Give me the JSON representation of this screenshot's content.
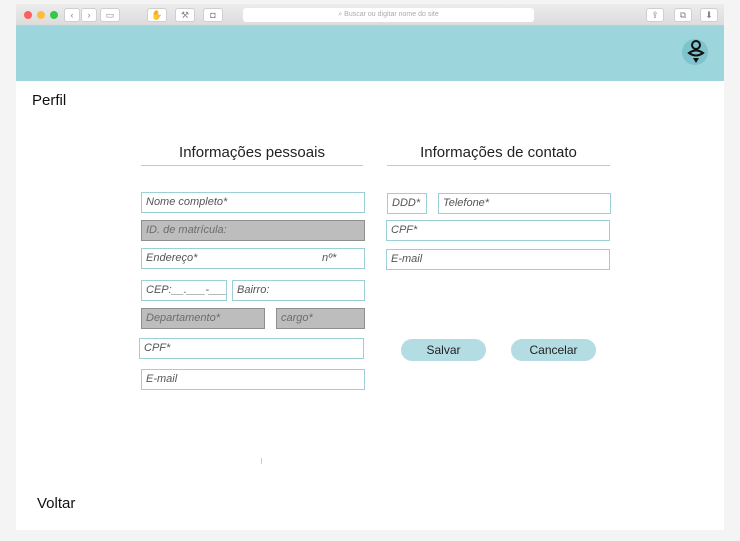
{
  "browser": {
    "address_placeholder": "Buscar ou digitar nome do site"
  },
  "header": {
    "avatar_icon": "user-avatar-icon",
    "colors": {
      "topbar": "#9dd5dc",
      "field_border": "#9ccfd6",
      "button": "#b3dde2"
    }
  },
  "page": {
    "title": "Perfil",
    "back_label": "Voltar"
  },
  "personal": {
    "title": "Informações pessoais",
    "full_name": "Nome completo*",
    "enrollment_id": "ID. de matrícula:",
    "address": "Endereço*",
    "number": "nº*",
    "cep": "CEP:__.___-___",
    "neighborhood": "Bairro:",
    "department": "Departamento*",
    "role": "cargo*",
    "cpf": "CPF*",
    "email": "E-mail"
  },
  "contact": {
    "title": "Informações de contato",
    "ddd": "DDD*",
    "phone": "Telefone*",
    "cpf": "CPF*",
    "email": "E-mail"
  },
  "actions": {
    "save_label": "Salvar",
    "cancel_label": "Cancelar"
  }
}
